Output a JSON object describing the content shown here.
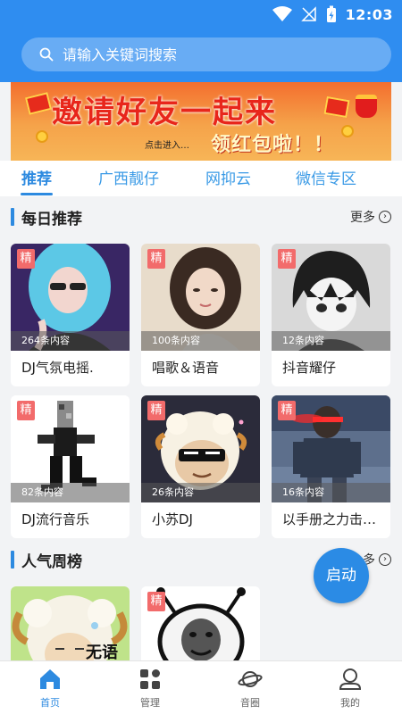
{
  "status_bar": {
    "time": "12:03"
  },
  "search": {
    "placeholder": "请输入关键词搜索"
  },
  "banner": {
    "title": "邀请好友一起来",
    "hint": "点击进入…",
    "subtitle": "领红包啦！！"
  },
  "tabs": [
    {
      "label": "推荐",
      "active": true
    },
    {
      "label": "广西靓仔",
      "active": false
    },
    {
      "label": "网抑云",
      "active": false
    },
    {
      "label": "微信专区",
      "active": false
    }
  ],
  "daily": {
    "title": "每日推荐",
    "more_label": "更多",
    "cards": [
      {
        "badge": "精",
        "count": "264条内容",
        "name": "DJ气氛电摇."
      },
      {
        "badge": "精",
        "count": "100条内容",
        "name": "唱歌＆语音"
      },
      {
        "badge": "精",
        "count": "12条内容",
        "name": "抖音耀仔"
      },
      {
        "badge": "精",
        "count": "82条内容",
        "name": "DJ流行音乐"
      },
      {
        "badge": "精",
        "count": "26条内容",
        "name": "小苏DJ"
      },
      {
        "badge": "精",
        "count": "16条内容",
        "name": "以手册之力击…"
      }
    ]
  },
  "popular": {
    "title": "人气周榜",
    "more_label": "多",
    "cards": [
      {
        "badge": "",
        "overlay_text": "无语"
      },
      {
        "badge": "精"
      }
    ]
  },
  "fab": {
    "label": "启动"
  },
  "navbar": [
    {
      "label": "首页",
      "icon": "home-icon",
      "active": true
    },
    {
      "label": "管理",
      "icon": "grid-icon",
      "active": false
    },
    {
      "label": "音圈",
      "icon": "planet-icon",
      "active": false
    },
    {
      "label": "我的",
      "icon": "profile-icon",
      "active": false
    }
  ],
  "colors": {
    "primary": "#2d8ae0",
    "header": "#2f8df0",
    "badge": "#f26b6b"
  }
}
